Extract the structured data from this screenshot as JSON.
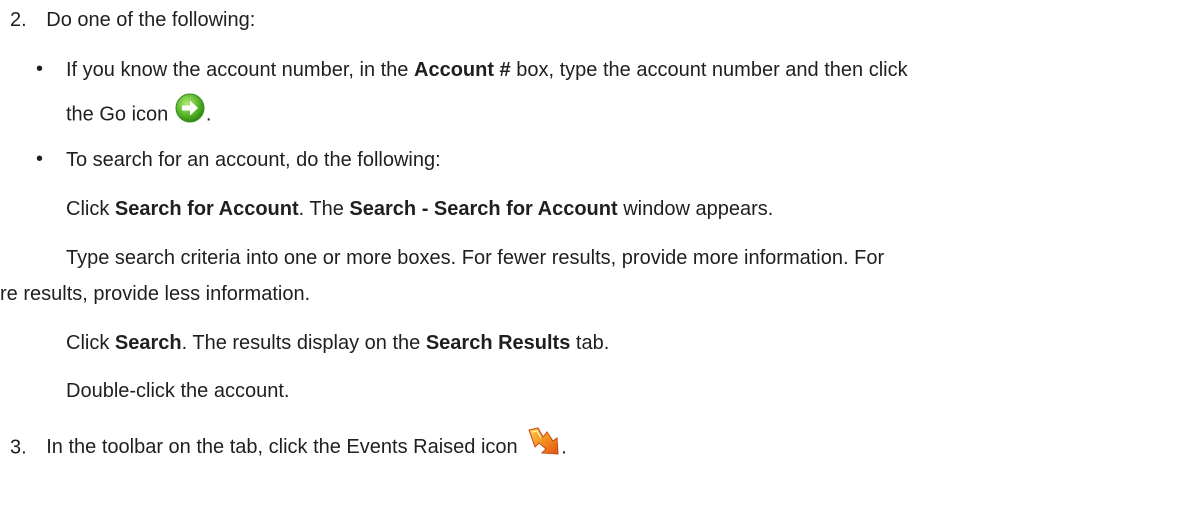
{
  "steps": {
    "step2": {
      "number": "2.",
      "text": "Do one of the following:"
    },
    "bullet1": {
      "marker": "•",
      "part1": "If you know the account number, in the ",
      "bold1": "Account #",
      "part2": " box, type the account number and then click",
      "line2_text": "the Go icon",
      "line2_end": ".",
      "icon": "go-arrow-icon",
      "icon_color": "#5cb82d"
    },
    "bullet2": {
      "marker": "•",
      "text": "To search for an account, do the following:"
    },
    "sub1": {
      "part1": "Click ",
      "bold1": "Search for Account",
      "part2": ". The ",
      "bold2": "Search - Search for Account",
      "part3": " window appears."
    },
    "sub2": {
      "line1": "Type search criteria into one or more boxes. For fewer results, provide more information. For",
      "line2": "re results, provide less information."
    },
    "sub3": {
      "part1": "Click ",
      "bold1": "Search",
      "part2": ". The results display on the ",
      "bold2": "Search Results",
      "part3": " tab."
    },
    "sub4": {
      "text": "Double-click the account."
    },
    "step3": {
      "number": "3.",
      "text": "In the toolbar on the tab, click the Events Raised icon",
      "end": ".",
      "icon": "events-raised-icon",
      "icon_color": "#f28a1e"
    }
  }
}
